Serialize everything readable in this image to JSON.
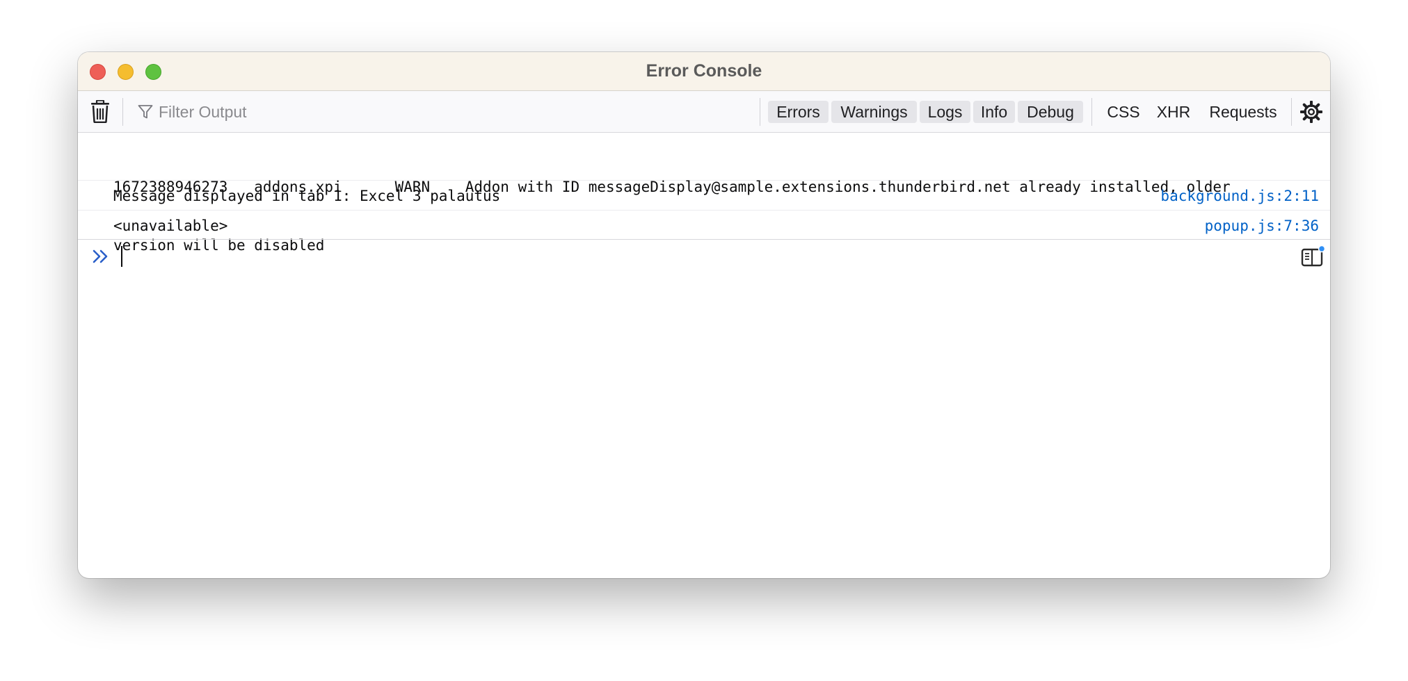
{
  "window": {
    "title": "Error Console"
  },
  "toolbar": {
    "filter_placeholder": "Filter Output",
    "levels": [
      "Errors",
      "Warnings",
      "Logs",
      "Info",
      "Debug"
    ],
    "requests": [
      "CSS",
      "XHR",
      "Requests"
    ],
    "icons": {
      "clear": "trash-icon",
      "filter": "filter-icon",
      "settings": "gear-icon"
    }
  },
  "log": {
    "entries": [
      {
        "lines": [
          "1672388946273   addons.xpi      WARN    Addon with ID messageDisplay@sample.extensions.thunderbird.net already installed, older",
          "version will be disabled"
        ],
        "source": ""
      },
      {
        "lines": [
          "Message displayed in tab 1: Excel 3 palautus"
        ],
        "source": "background.js:2:11"
      },
      {
        "lines": [
          "<unavailable>"
        ],
        "source": "popup.js:7:36"
      }
    ]
  },
  "prompt": {
    "input_value": "",
    "icons": {
      "prompt": "double-chevron-icon",
      "sidebar": "sidebar-toggle-icon"
    }
  },
  "colors": {
    "titlebar_bg": "#f8f3ea",
    "toolbar_bg": "#f9f9fb",
    "level_button_bg": "#e5e5e9",
    "link_blue": "#0061c7",
    "prompt_blue": "#2a5fc9",
    "notification_dot": "#2f8ff5",
    "close": "#ee5f57",
    "minimize": "#f5bd2f",
    "zoom": "#5fc240"
  }
}
